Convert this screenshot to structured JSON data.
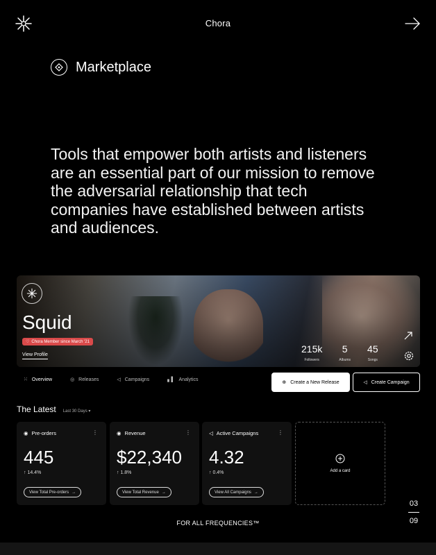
{
  "header": {
    "brand": "Chora",
    "logo_icon": "asterisk-star-icon",
    "next_icon": "arrow-right-icon"
  },
  "section": {
    "icon": "diamond-circle-icon",
    "title": "Marketplace"
  },
  "mission": {
    "text": "Tools that empower both artists and listeners are an essential part of our mission to remove the adversarial relationship that tech companies have established between artists and audiences."
  },
  "profile": {
    "artist": "Squid",
    "member_badge": "Chora Member since March '21",
    "view_profile": "View Profile",
    "stats": [
      {
        "value": "215k",
        "label": "Followers"
      },
      {
        "value": "5",
        "label": "Albums"
      },
      {
        "value": "45",
        "label": "Songs"
      }
    ]
  },
  "tabs": [
    {
      "label": "Overview",
      "icon": "grid-icon"
    },
    {
      "label": "Releases",
      "icon": "disc-icon"
    },
    {
      "label": "Campaigns",
      "icon": "megaphone-icon"
    },
    {
      "label": "Analytics",
      "icon": "bar-chart-icon"
    }
  ],
  "actions": {
    "new_release": "Create a New Release",
    "campaign": "Create Campaign"
  },
  "latest": {
    "title": "The Latest",
    "range": "Last 30 Days"
  },
  "cards": [
    {
      "title": "Pre-orders",
      "value": "445",
      "delta": "↑ 14.4%",
      "link": "View Total Pre-orders"
    },
    {
      "title": "Revenue",
      "value": "$22,340",
      "delta": "↑ 1.8%",
      "link": "View Total Revenue"
    },
    {
      "title": "Active Campaigns",
      "value": "4.32",
      "delta": "↑ 0.4%",
      "link": "View All Campaigns"
    }
  ],
  "add_card": "Add a card",
  "pager": {
    "current": "03",
    "total": "09"
  },
  "footer": "FOR ALL FREQUENCIES™"
}
